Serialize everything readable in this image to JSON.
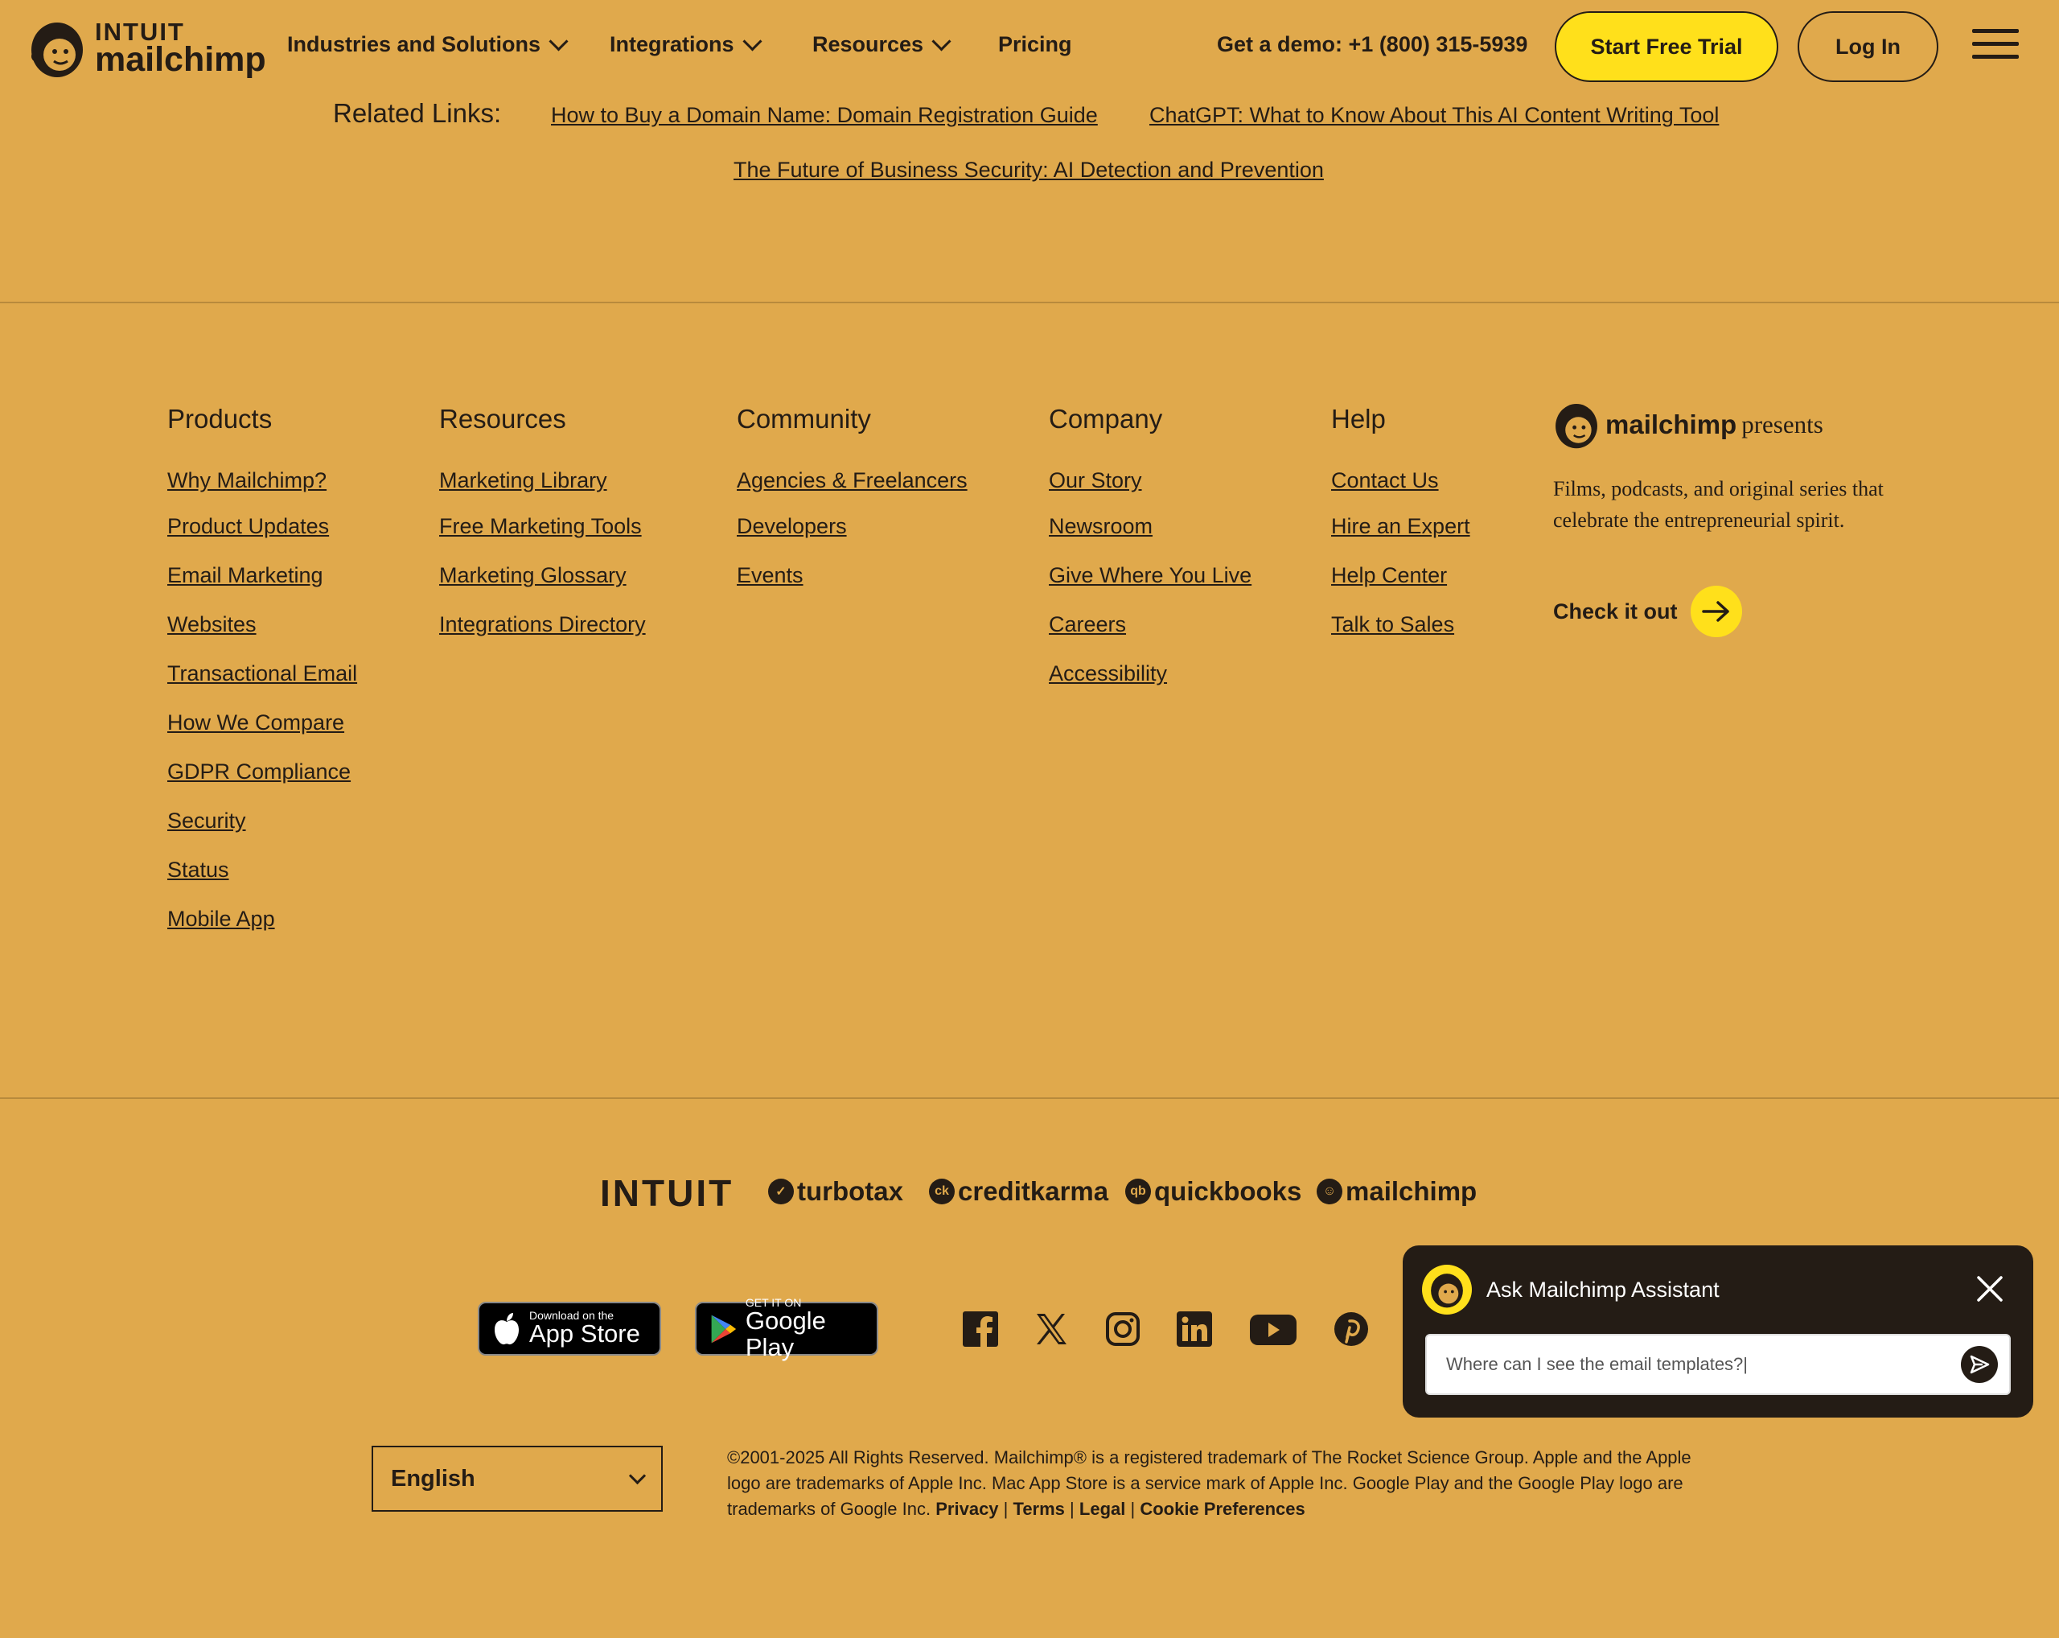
{
  "header": {
    "logo_top": "INTUIT",
    "logo_bottom": "mailchimp",
    "nav": [
      {
        "label": "Industries and Solutions"
      },
      {
        "label": "Integrations"
      },
      {
        "label": "Resources"
      },
      {
        "label": "Pricing"
      }
    ],
    "demo": "Get a demo: +1 (800) 315-5939",
    "trial_button": "Start Free Trial",
    "login_button": "Log In"
  },
  "related": {
    "title": "Related Links:",
    "links": [
      "How to Buy a Domain Name: Domain Registration Guide",
      "ChatGPT: What to Know About This AI Content Writing Tool",
      "The Future of Business Security: AI Detection and Prevention"
    ]
  },
  "footer": {
    "columns": [
      {
        "heading": "Products",
        "links": [
          "Why Mailchimp?",
          "Product Updates",
          "Email Marketing",
          "Websites",
          "Transactional Email",
          "How We Compare",
          "GDPR Compliance",
          "Security",
          "Status",
          "Mobile App"
        ]
      },
      {
        "heading": "Resources",
        "links": [
          "Marketing Library",
          "Free Marketing Tools",
          "Marketing Glossary",
          "Integrations Directory"
        ]
      },
      {
        "heading": "Community",
        "links": [
          "Agencies & Freelancers",
          "Developers",
          "Events"
        ]
      },
      {
        "heading": "Company",
        "links": [
          "Our Story",
          "Newsroom",
          "Give Where You Live",
          "Careers",
          "Accessibility"
        ]
      },
      {
        "heading": "Help",
        "links": [
          "Contact Us",
          "Hire an Expert",
          "Help Center",
          "Talk to Sales"
        ]
      }
    ],
    "presents": {
      "brand": "mailchimp",
      "word": "presents",
      "description": "Films, podcasts, and original series that celebrate the entrepreneurial spirit.",
      "cta": "Check it out"
    }
  },
  "brands": {
    "intuit": "INTUIT",
    "turbotax": "turbotax",
    "creditkarma": "creditkarma",
    "creditkarma_mark": "ck",
    "quickbooks": "quickbooks",
    "quickbooks_mark": "qb",
    "mailchimp": "mailchimp"
  },
  "stores": {
    "apple_small": "Download on the",
    "apple_big": "App Store",
    "google_small": "GET IT ON",
    "google_big": "Google Play"
  },
  "social_icons": [
    "facebook-icon",
    "x-icon",
    "instagram-icon",
    "linkedin-icon",
    "youtube-icon",
    "pinterest-icon"
  ],
  "language": {
    "selected": "English"
  },
  "legal": {
    "text": "©2001-2025 All Rights Reserved. Mailchimp® is a registered trademark of The Rocket Science Group. Apple and the Apple logo are trademarks of Apple Inc. Mac App Store is a service mark of Apple Inc. Google Play and the Google Play logo are trademarks of Google Inc.",
    "privacy": "Privacy",
    "terms": "Terms",
    "legal": "Legal",
    "cookies": "Cookie Preferences",
    "separator": "|"
  },
  "chat": {
    "title": "Ask Mailchimp Assistant",
    "input_value": "Where can I see the email templates?|"
  },
  "colors": {
    "background": "#e0a94c",
    "accent_yellow": "#ffe01b",
    "ink": "#241c15"
  }
}
